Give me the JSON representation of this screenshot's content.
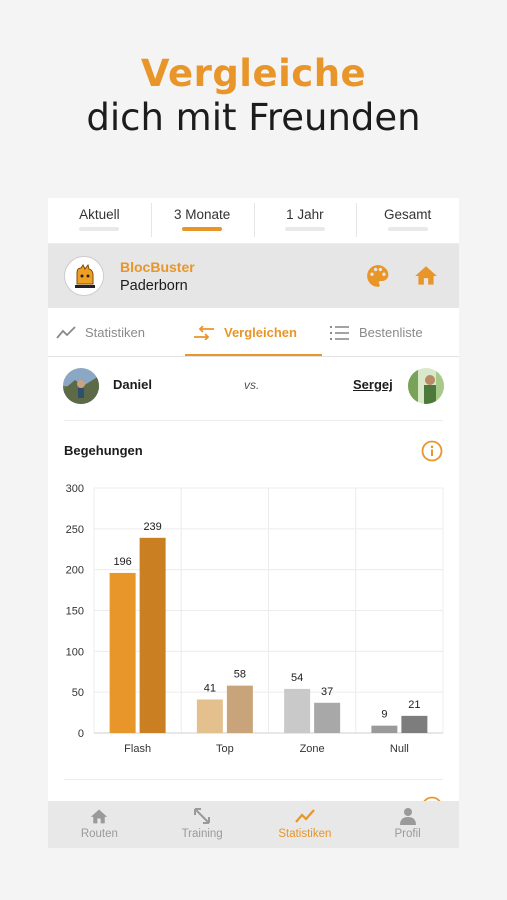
{
  "promo": {
    "line1": "Vergleiche",
    "line2": "dich mit Freunden"
  },
  "period_tabs": [
    {
      "label": "Aktuell",
      "active": false
    },
    {
      "label": "3 Monate",
      "active": true
    },
    {
      "label": "1 Jahr",
      "active": false
    },
    {
      "label": "Gesamt",
      "active": false
    }
  ],
  "gym": {
    "name": "BlocBuster",
    "city": "Paderborn",
    "logo_text": "BLOC BUSTER"
  },
  "stat_tabs": [
    {
      "label": "Statistiken",
      "icon": "trend-line-icon",
      "active": false
    },
    {
      "label": "Vergleichen",
      "icon": "swap-arrows-icon",
      "active": true
    },
    {
      "label": "Bestenliste",
      "icon": "list-icon",
      "active": false
    }
  ],
  "compare": {
    "user_left": "Daniel",
    "vs_label": "vs.",
    "user_right": "Sergej"
  },
  "section": {
    "title": "Begehungen"
  },
  "chart_data": {
    "type": "bar",
    "title": "Begehungen",
    "xlabel": "",
    "ylabel": "",
    "categories": [
      "Flash",
      "Top",
      "Zone",
      "Null"
    ],
    "series": [
      {
        "values": [
          196,
          41,
          54,
          9
        ]
      },
      {
        "values": [
          239,
          58,
          37,
          21
        ]
      }
    ],
    "ylim": [
      0,
      300
    ],
    "yticks": [
      0,
      50,
      100,
      150,
      200,
      250,
      300
    ],
    "grid": true,
    "colors": [
      [
        "#e8952a",
        "#c97f22"
      ],
      [
        "#e3c08e",
        "#c9a47a"
      ],
      [
        "#c9c9c9",
        "#a8a8a8"
      ],
      [
        "#9a9a9a",
        "#7d7d7d"
      ]
    ]
  },
  "bottom_nav": [
    {
      "label": "Routen",
      "icon": "home-icon",
      "active": false
    },
    {
      "label": "Training",
      "icon": "expand-arrows-icon",
      "active": false
    },
    {
      "label": "Statistiken",
      "icon": "trend-line-icon",
      "active": true
    },
    {
      "label": "Profil",
      "icon": "person-icon",
      "active": false
    }
  ],
  "colors": {
    "accent": "#e8952a",
    "header_bg": "#e6e6e6",
    "nav_bg": "#e8e8e8"
  }
}
